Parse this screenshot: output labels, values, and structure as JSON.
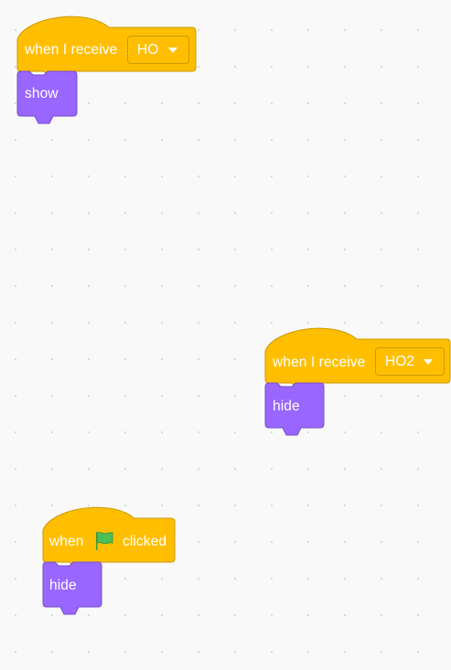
{
  "workspace": {
    "scripts": [
      {
        "hat": {
          "label": "when I receive",
          "message": "HO"
        },
        "stack": [
          {
            "label": "show"
          }
        ]
      },
      {
        "hat": {
          "label": "when I receive",
          "message": "HO2"
        },
        "stack": [
          {
            "label": "hide"
          }
        ]
      },
      {
        "hat": {
          "label_before": "when",
          "icon": "green-flag-icon",
          "label_after": "clicked"
        },
        "stack": [
          {
            "label": "hide"
          }
        ]
      }
    ]
  },
  "colors": {
    "events_block": "#ffbf00",
    "events_border": "#cc9900",
    "looks_block": "#9966ff",
    "looks_border": "#774dcb",
    "flag_green": "#4cbf56",
    "background": "#f9f9f9"
  }
}
